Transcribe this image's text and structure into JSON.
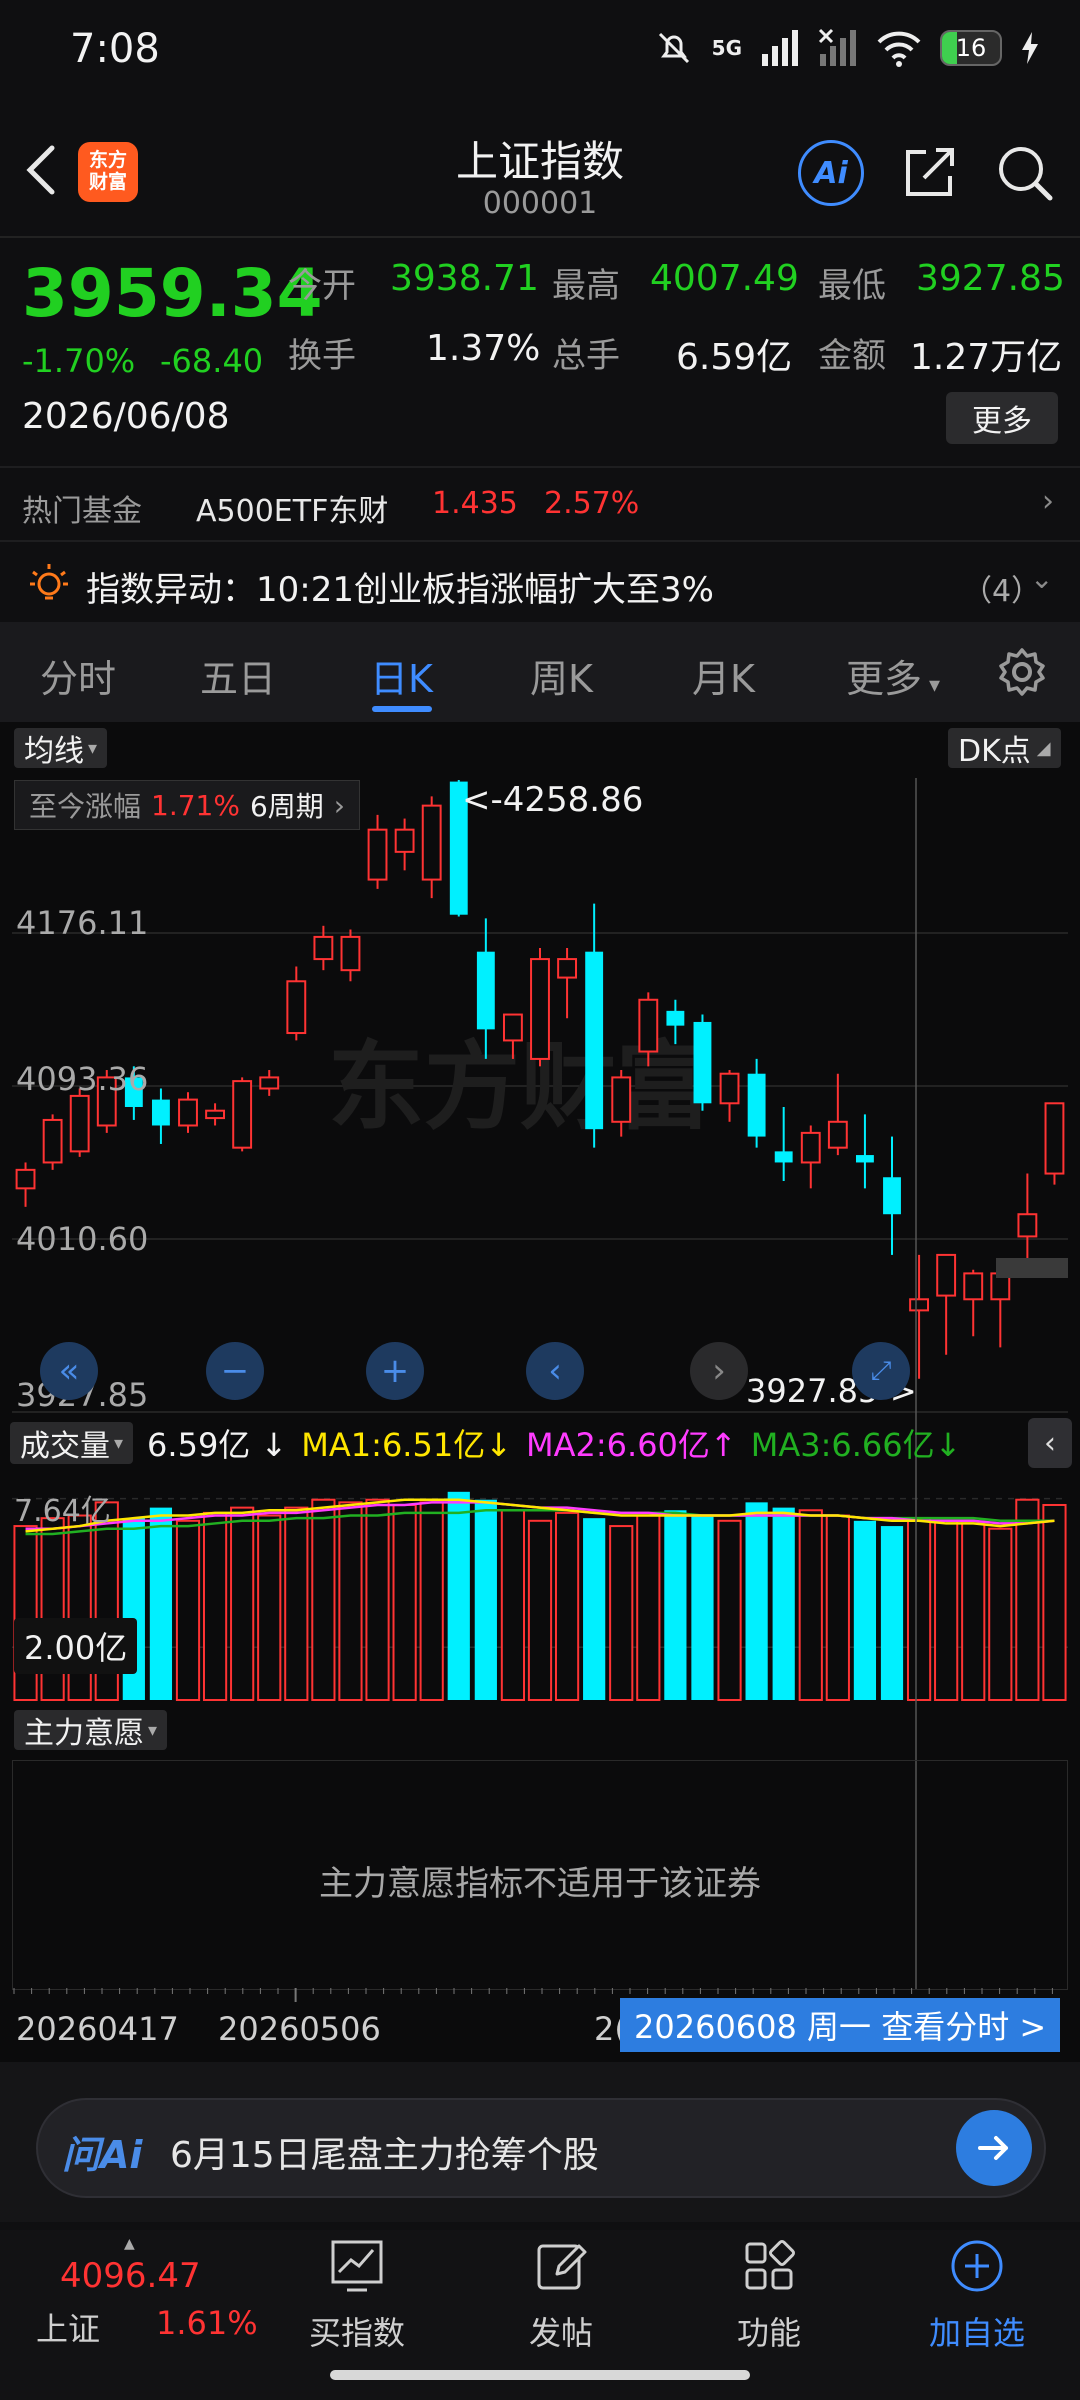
{
  "status_bar": {
    "time": "7:08",
    "network": "5G",
    "battery": "16"
  },
  "header": {
    "title": "上证指数",
    "code": "000001",
    "logo_line1": "东方",
    "logo_line2": "财富",
    "ai_label": "Ai"
  },
  "quote": {
    "price": "3959.34",
    "change_pct": "-1.70%",
    "change_val": "-68.40",
    "date": "2026/06/08",
    "open_label": "今开",
    "open": "3938.71",
    "high_label": "最高",
    "high": "4007.49",
    "low_label": "最低",
    "low": "3927.85",
    "turnover_label": "换手",
    "turnover": "1.37%",
    "volume_label": "总手",
    "volume": "6.59亿",
    "amount_label": "金额",
    "amount": "1.27万亿",
    "more_label": "更多"
  },
  "hot_fund": {
    "label": "热门基金",
    "name": "A500ETF东财",
    "price": "1.435",
    "pct": "2.57%"
  },
  "alert": {
    "text": "指数异动：10:21创业板指涨幅扩大至3%",
    "count": "（4）"
  },
  "tabs": [
    {
      "label": "分时",
      "active": false
    },
    {
      "label": "五日",
      "active": false
    },
    {
      "label": "日K",
      "active": true
    },
    {
      "label": "周K",
      "active": false
    },
    {
      "label": "月K",
      "active": false
    },
    {
      "label": "更多",
      "active": false
    }
  ],
  "chart": {
    "ma_chip": "均线",
    "dk_chip": "DK点",
    "since_label": "至今涨幅",
    "since_pct": "1.71%",
    "since_period": "6周期",
    "max_label": "<-4258.86",
    "min_label": "3927.85->",
    "watermark": "东方财富",
    "price_ticks": [
      "4176.11",
      "4093.36",
      "4010.60",
      "3927.85"
    ]
  },
  "volume": {
    "chip": "成交量",
    "value": "6.59亿",
    "value_arrow": "↓",
    "ma1": "MA1:6.51亿",
    "ma1_arrow": "↓",
    "ma2": "MA2:6.60亿",
    "ma2_arrow": "↑",
    "ma3": "MA3:6.66亿",
    "ma3_arrow": "↓",
    "tick_top": "7.64亿",
    "tick_mid": "2.00亿"
  },
  "main_intent": {
    "chip": "主力意愿",
    "message": "主力意愿指标不适用于该证券"
  },
  "date_axis": {
    "tick1": "20260417",
    "tick2": "20260506",
    "tick3": "2(",
    "badge": "20260608 周一 查看分时 >"
  },
  "ai_bar": {
    "brand": "问Ai",
    "prompt": "6月15日尾盘主力抢筹个股"
  },
  "bottom_nav": {
    "index_value": "4096.47",
    "index_name": "上证",
    "index_pct": "1.61%",
    "items": [
      {
        "label": "买指数",
        "active": false
      },
      {
        "label": "发帖",
        "active": false
      },
      {
        "label": "功能",
        "active": false
      },
      {
        "label": "加自选",
        "active": true
      }
    ]
  },
  "colors": {
    "up": "#ff3333",
    "down": "#00f0ff",
    "accent": "#3f8cff",
    "price_down": "#21d021"
  },
  "chart_data": {
    "type": "candlestick",
    "ylim": [
      3927.85,
      4258.86
    ],
    "candles": [
      {
        "o": 4038,
        "h": 4052,
        "l": 4028,
        "c": 4048
      },
      {
        "o": 4052,
        "h": 4078,
        "l": 4048,
        "c": 4075
      },
      {
        "o": 4058,
        "h": 4092,
        "l": 4055,
        "c": 4088
      },
      {
        "o": 4072,
        "h": 4102,
        "l": 4068,
        "c": 4098
      },
      {
        "o": 4098,
        "h": 4104,
        "l": 4075,
        "c": 4082
      },
      {
        "o": 4086,
        "h": 4092,
        "l": 4062,
        "c": 4072
      },
      {
        "o": 4072,
        "h": 4090,
        "l": 4068,
        "c": 4086
      },
      {
        "o": 4076,
        "h": 4084,
        "l": 4072,
        "c": 4080
      },
      {
        "o": 4060,
        "h": 4098,
        "l": 4058,
        "c": 4096
      },
      {
        "o": 4092,
        "h": 4102,
        "l": 4088,
        "c": 4098
      },
      {
        "o": 4122,
        "h": 4158,
        "l": 4118,
        "c": 4150
      },
      {
        "o": 4162,
        "h": 4180,
        "l": 4156,
        "c": 4174
      },
      {
        "o": 4156,
        "h": 4178,
        "l": 4150,
        "c": 4174
      },
      {
        "o": 4205,
        "h": 4240,
        "l": 4200,
        "c": 4232
      },
      {
        "o": 4220,
        "h": 4238,
        "l": 4210,
        "c": 4232
      },
      {
        "o": 4205,
        "h": 4250,
        "l": 4195,
        "c": 4245
      },
      {
        "o": 4258,
        "h": 4258.86,
        "l": 4185,
        "c": 4186
      },
      {
        "o": 4166,
        "h": 4184,
        "l": 4108,
        "c": 4124
      },
      {
        "o": 4118,
        "h": 4132,
        "l": 4108,
        "c": 4132
      },
      {
        "o": 4108,
        "h": 4168,
        "l": 4104,
        "c": 4162
      },
      {
        "o": 4152,
        "h": 4168,
        "l": 4130,
        "c": 4162
      },
      {
        "o": 4166,
        "h": 4192,
        "l": 4060,
        "c": 4070
      },
      {
        "o": 4074,
        "h": 4102,
        "l": 4066,
        "c": 4098
      },
      {
        "o": 4112,
        "h": 4144,
        "l": 4104,
        "c": 4140
      },
      {
        "o": 4134,
        "h": 4140,
        "l": 4116,
        "c": 4126
      },
      {
        "o": 4128,
        "h": 4132,
        "l": 4080,
        "c": 4084
      },
      {
        "o": 4084,
        "h": 4102,
        "l": 4074,
        "c": 4100
      },
      {
        "o": 4100,
        "h": 4108,
        "l": 4060,
        "c": 4066
      },
      {
        "o": 4058,
        "h": 4082,
        "l": 4042,
        "c": 4052
      },
      {
        "o": 4052,
        "h": 4072,
        "l": 4038,
        "c": 4068
      },
      {
        "o": 4060,
        "h": 4100,
        "l": 4056,
        "c": 4074
      },
      {
        "o": 4056,
        "h": 4078,
        "l": 4038,
        "c": 4052
      },
      {
        "o": 4044,
        "h": 4066,
        "l": 4002,
        "c": 4024
      },
      {
        "o": 3972,
        "h": 4002,
        "l": 3935,
        "c": 3978
      },
      {
        "o": 3980,
        "h": 4002,
        "l": 3948,
        "c": 4002
      },
      {
        "o": 3978,
        "h": 3994,
        "l": 3958,
        "c": 3992
      },
      {
        "o": 3978,
        "h": 3996,
        "l": 3952,
        "c": 3992
      },
      {
        "o": 4012,
        "h": 4046,
        "l": 4000,
        "c": 4024
      },
      {
        "o": 4046,
        "h": 4084,
        "l": 4040,
        "c": 4084
      }
    ],
    "volume_ylim": [
      0,
      8.5
    ],
    "volumes": [
      6.6,
      6.9,
      7.0,
      7.5,
      6.9,
      7.3,
      6.8,
      7.1,
      7.3,
      7.0,
      7.3,
      7.6,
      7.5,
      7.6,
      7.4,
      7.5,
      7.9,
      7.6,
      7.2,
      6.8,
      7.1,
      6.9,
      6.6,
      7.0,
      7.2,
      7.0,
      6.8,
      7.5,
      7.3,
      7.2,
      7.0,
      6.8,
      6.6,
      6.9,
      6.8,
      6.7,
      6.5,
      7.6,
      7.4
    ],
    "ma1": [
      6.4,
      6.5,
      6.6,
      6.8,
      6.9,
      7.0,
      7.0,
      7.1,
      7.1,
      7.2,
      7.2,
      7.3,
      7.4,
      7.5,
      7.6,
      7.6,
      7.6,
      7.5,
      7.4,
      7.3,
      7.2,
      7.1,
      7.0,
      7.0,
      7.0,
      7.0,
      7.0,
      7.1,
      7.1,
      7.0,
      7.0,
      6.9,
      6.8,
      6.8,
      6.7,
      6.7,
      6.6,
      6.7,
      6.8
    ],
    "ma2": [
      6.5,
      6.5,
      6.6,
      6.7,
      6.8,
      6.8,
      6.9,
      7.0,
      7.0,
      7.1,
      7.1,
      7.2,
      7.3,
      7.4,
      7.4,
      7.5,
      7.5,
      7.5,
      7.4,
      7.3,
      7.3,
      7.2,
      7.1,
      7.1,
      7.0,
      7.0,
      7.0,
      7.0,
      7.0,
      7.0,
      7.0,
      6.9,
      6.9,
      6.8,
      6.8,
      6.8,
      6.7,
      6.7,
      6.8
    ],
    "ma3": [
      6.3,
      6.3,
      6.4,
      6.5,
      6.5,
      6.6,
      6.6,
      6.7,
      6.8,
      6.8,
      6.9,
      6.9,
      7.0,
      7.0,
      7.1,
      7.1,
      7.1,
      7.2,
      7.2,
      7.2,
      7.2,
      7.1,
      7.1,
      7.1,
      7.1,
      7.0,
      7.0,
      7.0,
      7.0,
      7.0,
      7.0,
      6.9,
      6.9,
      6.9,
      6.9,
      6.9,
      6.8,
      6.8,
      6.8
    ]
  }
}
